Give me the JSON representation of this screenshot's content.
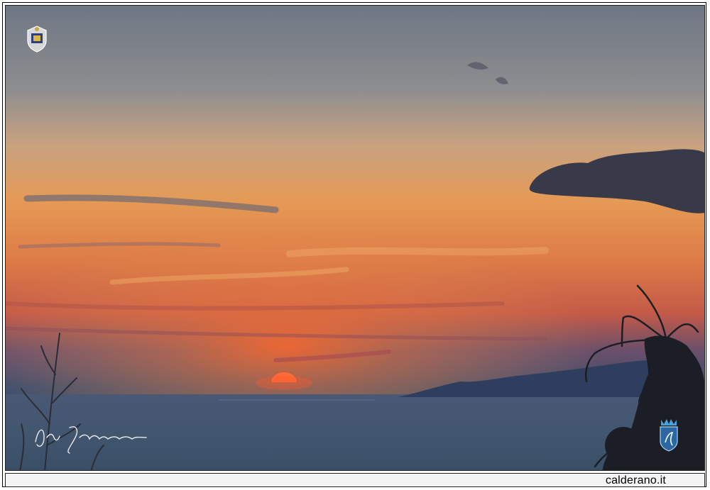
{
  "site": {
    "name": "calderano.it"
  },
  "overlays": {
    "top_left_logo": "crest-logo-icon",
    "bottom_right_logo": "shield-logo-icon",
    "signature": "handwritten-signature"
  },
  "colors": {
    "sky_top": "#6f7a86",
    "sky_glow": "#e59a55",
    "sun": "#ff5a2a",
    "sea": "#3f536d",
    "footer_bg": "#f4f4f4"
  }
}
